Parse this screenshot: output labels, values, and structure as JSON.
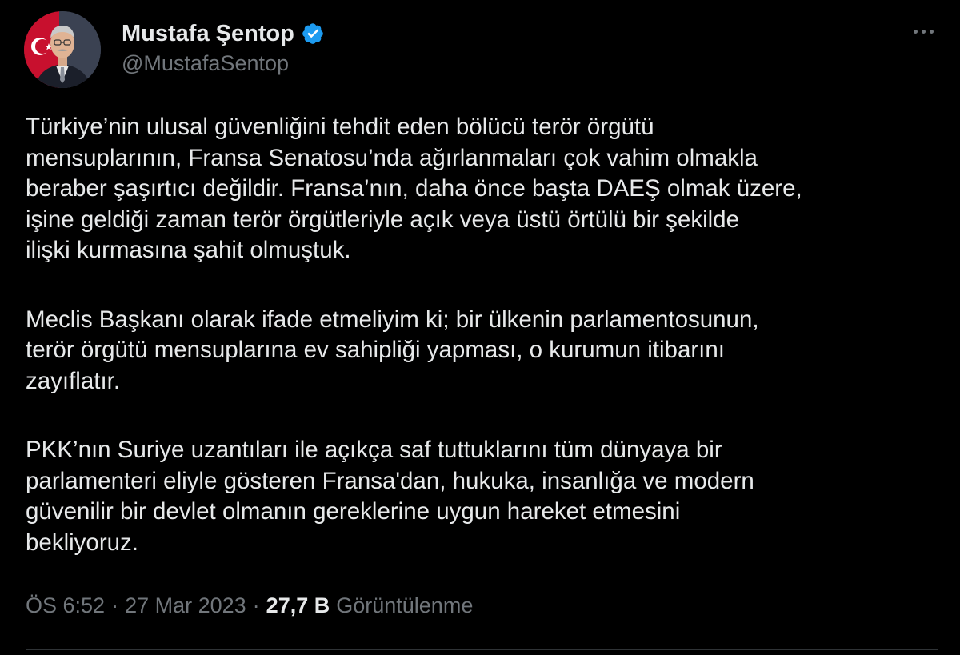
{
  "author": {
    "display_name": "Mustafa Şentop",
    "handle": "@MustafaSentop",
    "avatar_icon": "profile-photo",
    "verified_icon": "verified-badge-icon"
  },
  "tweet": {
    "paragraphs": [
      {
        "lines": [
          "Türkiye’nin ulusal güvenliğini tehdit eden bölücü terör örgütü",
          "mensuplarının, Fransa Senatosu’nda ağırlanmaları çok vahim olmakla",
          "beraber şaşırtıcı değildir. Fransa’nın, daha önce başta DAEŞ olmak üzere,",
          "işine geldiği zaman terör örgütleriyle açık veya üstü örtülü bir şekilde",
          "ilişki kurmasına şahit olmuştuk."
        ]
      },
      {
        "lines": [
          "Meclis Başkanı olarak ifade etmeliyim ki; bir ülkenin parlamentosunun,",
          "terör örgütü mensuplarına ev sahipliği yapması, o kurumun itibarını",
          "zayıflatır."
        ]
      },
      {
        "lines": [
          "PKK’nın Suriye uzantıları ile açıkça saf tuttuklarını tüm dünyaya bir",
          "parlamenteri eliyle gösteren Fransa'dan, hukuka, insanlığa ve modern",
          "güvenilir bir devlet olmanın gereklerine uygun hareket etmesini",
          "bekliyoruz."
        ]
      }
    ]
  },
  "meta": {
    "time": "ÖS 6:52",
    "separator": "·",
    "date": "27 Mar 2023",
    "views_count": "27,7 B",
    "views_label": "Görüntülenme"
  },
  "colors": {
    "background": "#000000",
    "text_primary": "#e7e9ea",
    "text_secondary": "#71767b",
    "verified_blue": "#1d9bf0",
    "divider": "#2f3336"
  }
}
